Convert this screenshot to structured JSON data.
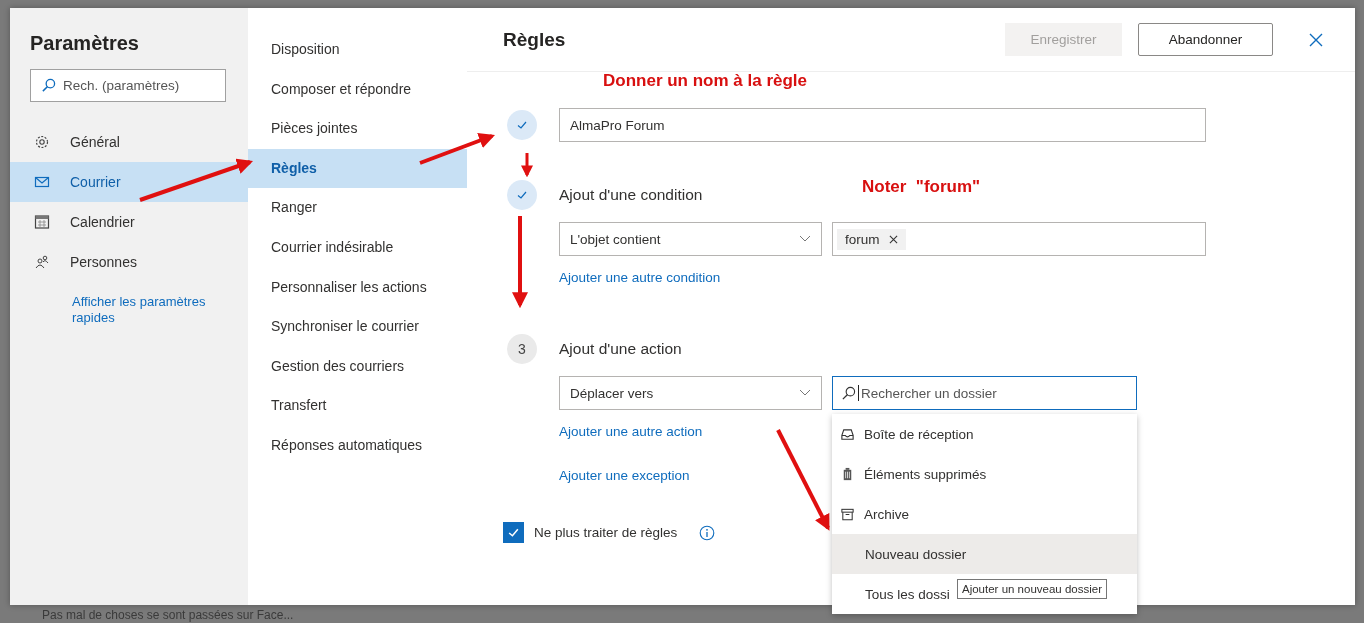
{
  "sidebar": {
    "title": "Paramètres",
    "search": {
      "placeholder": "Rech. (paramètres)"
    },
    "items": [
      {
        "label": "Général",
        "selected": false
      },
      {
        "label": "Courrier",
        "selected": true
      },
      {
        "label": "Calendrier",
        "selected": false
      },
      {
        "label": "Personnes",
        "selected": false
      }
    ],
    "link": "Afficher les paramètres rapides"
  },
  "submenu": {
    "items": [
      {
        "label": "Disposition",
        "selected": false
      },
      {
        "label": "Composer et répondre",
        "selected": false
      },
      {
        "label": "Pièces jointes",
        "selected": false
      },
      {
        "label": "Règles",
        "selected": true
      },
      {
        "label": "Ranger",
        "selected": false
      },
      {
        "label": "Courrier indésirable",
        "selected": false
      },
      {
        "label": "Personnaliser les actions",
        "selected": false
      },
      {
        "label": "Synchroniser le courrier",
        "selected": false
      },
      {
        "label": "Gestion des courriers",
        "selected": false
      },
      {
        "label": "Transfert",
        "selected": false
      },
      {
        "label": "Réponses automatiques",
        "selected": false
      }
    ]
  },
  "panel": {
    "title": "Règles",
    "buttons": [
      {
        "label": "Enregistrer",
        "disabled": true
      },
      {
        "label": "Abandonner",
        "disabled": false
      }
    ],
    "steps": [
      {
        "kind": "name",
        "done": true,
        "value": "AlmaPro Forum"
      },
      {
        "kind": "condition",
        "done": true,
        "title": "Ajout d'une condition",
        "select": "L'objet contient",
        "chips": [
          "forum"
        ],
        "links": [
          "Ajouter une autre condition"
        ]
      },
      {
        "kind": "action",
        "done": false,
        "number": "3",
        "title": "Ajout d'une action",
        "select": "Déplacer vers",
        "search": {
          "placeholder": "Rechercher un dossier"
        },
        "links": [
          "Ajouter une autre action",
          "Ajouter une exception"
        ]
      }
    ],
    "stop_processing": {
      "label": "Ne plus traiter de règles",
      "checked": true
    }
  },
  "folder_menu": {
    "items": [
      {
        "label": "Boîte de réception",
        "selected": false
      },
      {
        "label": "Éléments supprimés",
        "selected": false
      },
      {
        "label": "Archive",
        "selected": false
      },
      {
        "label": "Nouveau dossier",
        "selected": true
      },
      {
        "label": "Tous les dossi",
        "selected": false
      }
    ],
    "tooltip": "Ajouter un nouveau dossier"
  },
  "annotations": [
    "Donner un nom à la règle",
    "Noter  \"forum\""
  ],
  "background_text": "Pas mal de choses se sont passées sur Face..."
}
